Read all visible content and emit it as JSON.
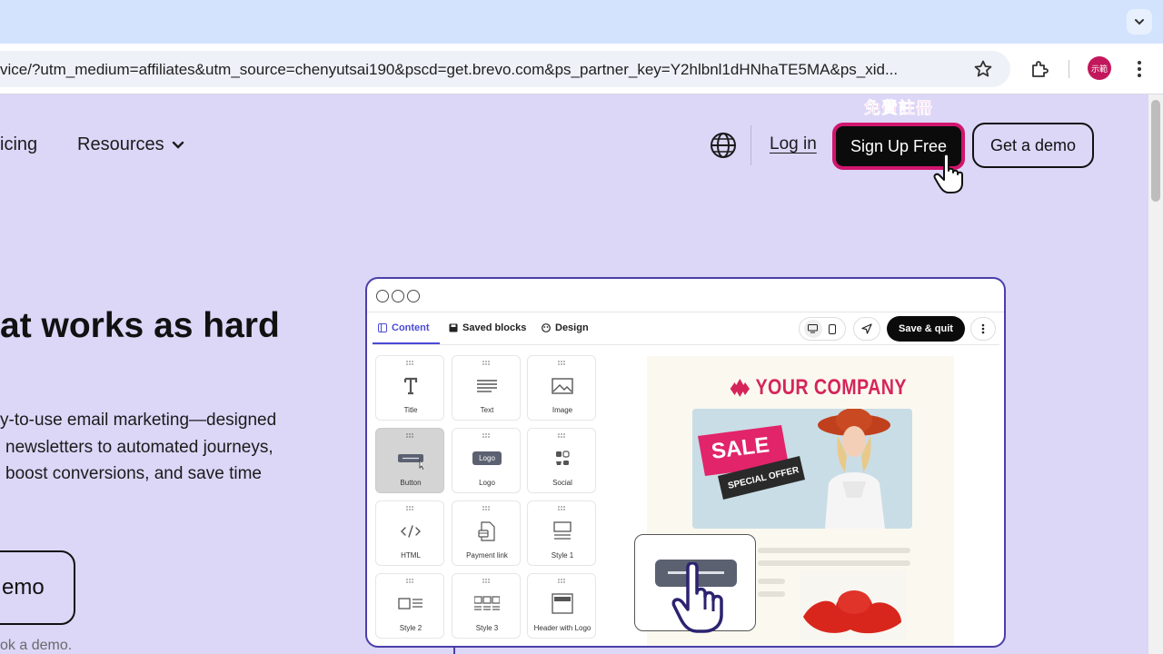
{
  "browser": {
    "url": "vice/?utm_medium=affiliates&utm_source=chenyutsai190&pscd=get.brevo.com&ps_partner_key=Y2hlbnl1dHNhaTE5MA&ps_xid...",
    "profile_initials": "示範",
    "icons": [
      "chevron-down-icon",
      "star-icon",
      "extensions-icon",
      "kebab-menu-icon"
    ]
  },
  "nav": {
    "pricing": "icing",
    "resources": "Resources",
    "login": "Log in",
    "signup_annotation": "免費註冊",
    "signup": "Sign Up Free",
    "get_demo": "Get a demo"
  },
  "hero": {
    "title": "at works as hard",
    "line1": "y-to-use email marketing—designed",
    "line2": "newsletters to automated journeys,",
    "line3": "boost conversions, and save time",
    "demo_button": "emo",
    "note": "ok a demo."
  },
  "editor": {
    "tabs": [
      "Content",
      "Saved blocks",
      "Design"
    ],
    "save_quit": "Save & quit",
    "blocks": [
      "Title",
      "Text",
      "Image",
      "Button",
      "Logo",
      "Social",
      "HTML",
      "Payment link",
      "Style 1",
      "Style 2",
      "Style 3",
      "Header with Logo"
    ],
    "logo_text": "Logo",
    "preview": {
      "company": "YOUR COMPANY",
      "sale": "SALE",
      "special_offer": "SPECIAL OFFER"
    }
  },
  "colors": {
    "page_bg": "#dcd6f7",
    "accent_pink": "#d1166d",
    "brand_dark": "#0b0b0b",
    "mock_border": "#4a3fa8",
    "company_red": "#d6245b"
  }
}
